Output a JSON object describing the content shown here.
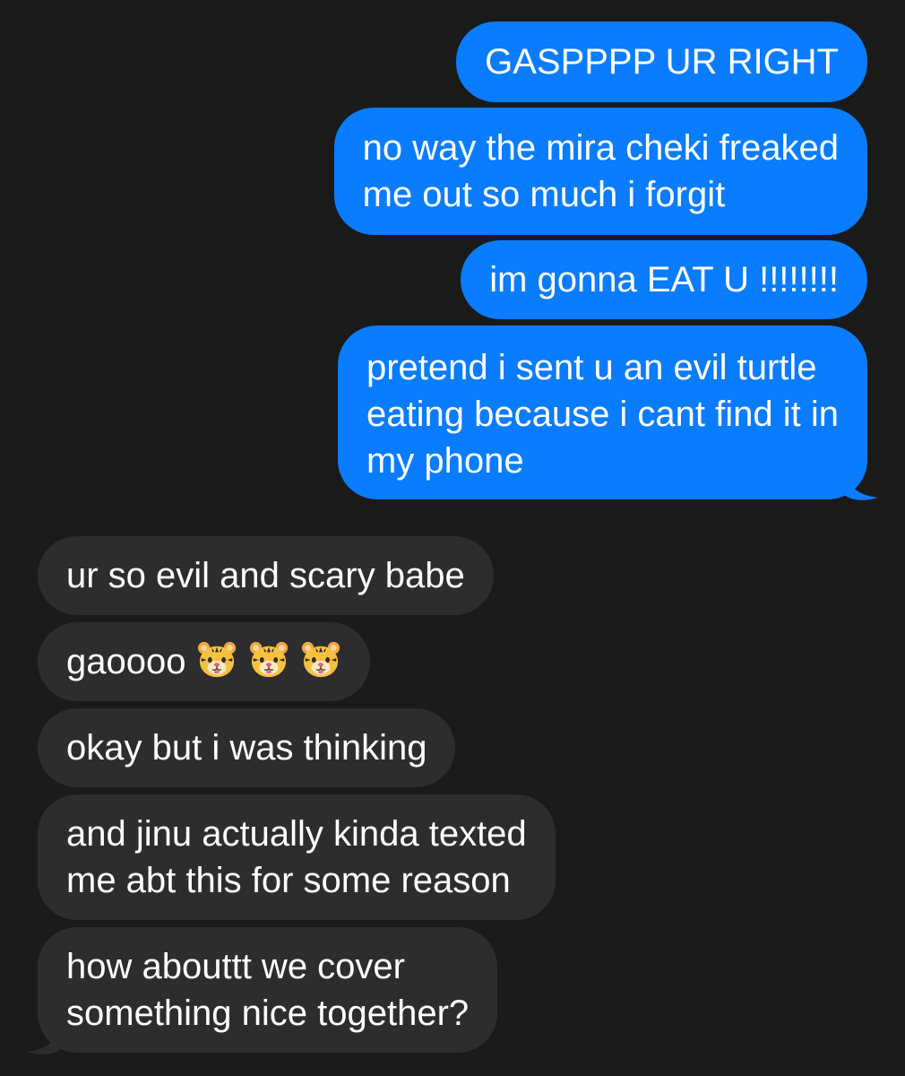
{
  "conversation": {
    "sent": [
      {
        "lines": [
          "GASPPPP UR RIGHT"
        ]
      },
      {
        "lines": [
          "no way the mira cheki freaked",
          "me out so much i forgit"
        ]
      },
      {
        "lines": [
          "im gonna EAT U !!!!!!!!"
        ]
      },
      {
        "lines": [
          "pretend i sent u an evil turtle",
          "eating because i cant find it in",
          "my phone"
        ]
      }
    ],
    "received": [
      {
        "lines": [
          "ur so evil and scary babe"
        ]
      },
      {
        "lines": [
          "gaoooo"
        ],
        "emoji": [
          "tiger-face-icon",
          "tiger-face-icon",
          "tiger-face-icon"
        ]
      },
      {
        "lines": [
          "okay but i was thinking"
        ]
      },
      {
        "lines": [
          "and jinu actually kinda texted",
          "me abt this for some reason"
        ]
      },
      {
        "lines": [
          "how abouttt we cover",
          "something nice together?"
        ]
      }
    ]
  },
  "colors": {
    "background": "#1a1a1a",
    "sent_bubble": "#0a7cff",
    "received_bubble": "#2d2d2f",
    "text": "#ffffff"
  }
}
